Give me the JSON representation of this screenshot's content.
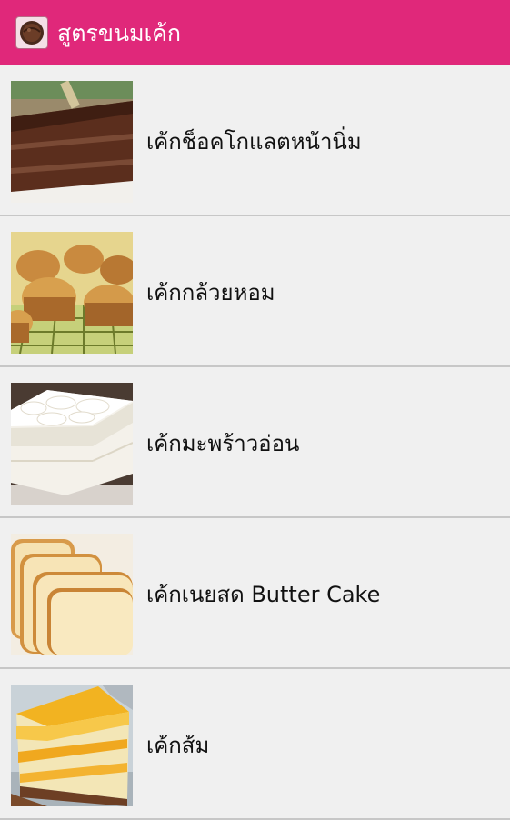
{
  "app_bar": {
    "icon": "chocolate-cake-logo-icon",
    "title": "สูตรขนมเค้ก",
    "color": "#e0287a"
  },
  "recipes": [
    {
      "title": "เค้กช็อคโกแลตหน้านิ่ม",
      "image": "chocolate-cake"
    },
    {
      "title": "เค้กกล้วยหอม",
      "image": "banana-cupcakes"
    },
    {
      "title": "เค้กมะพร้าวอ่อน",
      "image": "coconut-cake"
    },
    {
      "title": "เค้กเนยสด Butter Cake",
      "image": "butter-cake"
    },
    {
      "title": "เค้กส้ม",
      "image": "orange-cake"
    }
  ]
}
